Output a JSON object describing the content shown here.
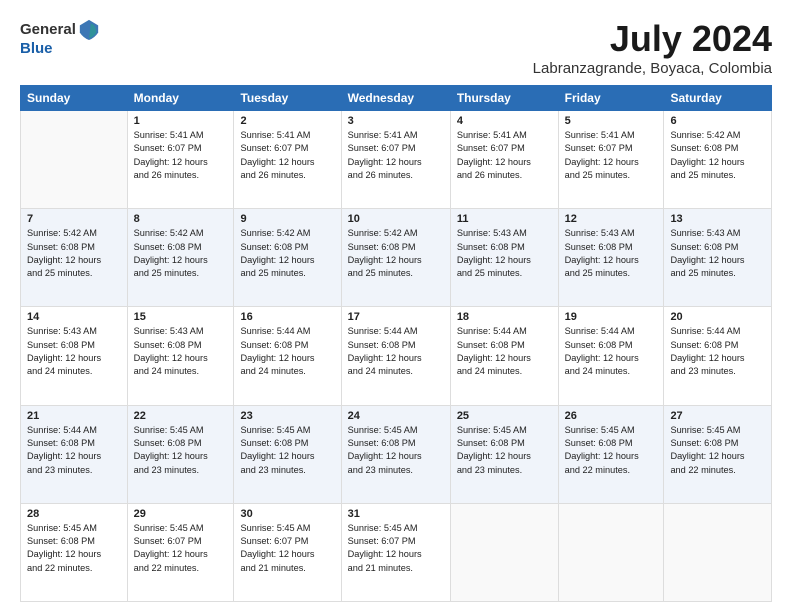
{
  "header": {
    "logo_general": "General",
    "logo_blue": "Blue",
    "month": "July 2024",
    "location": "Labranzagrande, Boyaca, Colombia"
  },
  "weekdays": [
    "Sunday",
    "Monday",
    "Tuesday",
    "Wednesday",
    "Thursday",
    "Friday",
    "Saturday"
  ],
  "weeks": [
    [
      {
        "day": "",
        "info": ""
      },
      {
        "day": "1",
        "info": "Sunrise: 5:41 AM\nSunset: 6:07 PM\nDaylight: 12 hours\nand 26 minutes."
      },
      {
        "day": "2",
        "info": "Sunrise: 5:41 AM\nSunset: 6:07 PM\nDaylight: 12 hours\nand 26 minutes."
      },
      {
        "day": "3",
        "info": "Sunrise: 5:41 AM\nSunset: 6:07 PM\nDaylight: 12 hours\nand 26 minutes."
      },
      {
        "day": "4",
        "info": "Sunrise: 5:41 AM\nSunset: 6:07 PM\nDaylight: 12 hours\nand 26 minutes."
      },
      {
        "day": "5",
        "info": "Sunrise: 5:41 AM\nSunset: 6:07 PM\nDaylight: 12 hours\nand 25 minutes."
      },
      {
        "day": "6",
        "info": "Sunrise: 5:42 AM\nSunset: 6:08 PM\nDaylight: 12 hours\nand 25 minutes."
      }
    ],
    [
      {
        "day": "7",
        "info": "Sunrise: 5:42 AM\nSunset: 6:08 PM\nDaylight: 12 hours\nand 25 minutes."
      },
      {
        "day": "8",
        "info": "Sunrise: 5:42 AM\nSunset: 6:08 PM\nDaylight: 12 hours\nand 25 minutes."
      },
      {
        "day": "9",
        "info": "Sunrise: 5:42 AM\nSunset: 6:08 PM\nDaylight: 12 hours\nand 25 minutes."
      },
      {
        "day": "10",
        "info": "Sunrise: 5:42 AM\nSunset: 6:08 PM\nDaylight: 12 hours\nand 25 minutes."
      },
      {
        "day": "11",
        "info": "Sunrise: 5:43 AM\nSunset: 6:08 PM\nDaylight: 12 hours\nand 25 minutes."
      },
      {
        "day": "12",
        "info": "Sunrise: 5:43 AM\nSunset: 6:08 PM\nDaylight: 12 hours\nand 25 minutes."
      },
      {
        "day": "13",
        "info": "Sunrise: 5:43 AM\nSunset: 6:08 PM\nDaylight: 12 hours\nand 25 minutes."
      }
    ],
    [
      {
        "day": "14",
        "info": "Sunrise: 5:43 AM\nSunset: 6:08 PM\nDaylight: 12 hours\nand 24 minutes."
      },
      {
        "day": "15",
        "info": "Sunrise: 5:43 AM\nSunset: 6:08 PM\nDaylight: 12 hours\nand 24 minutes."
      },
      {
        "day": "16",
        "info": "Sunrise: 5:44 AM\nSunset: 6:08 PM\nDaylight: 12 hours\nand 24 minutes."
      },
      {
        "day": "17",
        "info": "Sunrise: 5:44 AM\nSunset: 6:08 PM\nDaylight: 12 hours\nand 24 minutes."
      },
      {
        "day": "18",
        "info": "Sunrise: 5:44 AM\nSunset: 6:08 PM\nDaylight: 12 hours\nand 24 minutes."
      },
      {
        "day": "19",
        "info": "Sunrise: 5:44 AM\nSunset: 6:08 PM\nDaylight: 12 hours\nand 24 minutes."
      },
      {
        "day": "20",
        "info": "Sunrise: 5:44 AM\nSunset: 6:08 PM\nDaylight: 12 hours\nand 23 minutes."
      }
    ],
    [
      {
        "day": "21",
        "info": "Sunrise: 5:44 AM\nSunset: 6:08 PM\nDaylight: 12 hours\nand 23 minutes."
      },
      {
        "day": "22",
        "info": "Sunrise: 5:45 AM\nSunset: 6:08 PM\nDaylight: 12 hours\nand 23 minutes."
      },
      {
        "day": "23",
        "info": "Sunrise: 5:45 AM\nSunset: 6:08 PM\nDaylight: 12 hours\nand 23 minutes."
      },
      {
        "day": "24",
        "info": "Sunrise: 5:45 AM\nSunset: 6:08 PM\nDaylight: 12 hours\nand 23 minutes."
      },
      {
        "day": "25",
        "info": "Sunrise: 5:45 AM\nSunset: 6:08 PM\nDaylight: 12 hours\nand 23 minutes."
      },
      {
        "day": "26",
        "info": "Sunrise: 5:45 AM\nSunset: 6:08 PM\nDaylight: 12 hours\nand 22 minutes."
      },
      {
        "day": "27",
        "info": "Sunrise: 5:45 AM\nSunset: 6:08 PM\nDaylight: 12 hours\nand 22 minutes."
      }
    ],
    [
      {
        "day": "28",
        "info": "Sunrise: 5:45 AM\nSunset: 6:08 PM\nDaylight: 12 hours\nand 22 minutes."
      },
      {
        "day": "29",
        "info": "Sunrise: 5:45 AM\nSunset: 6:07 PM\nDaylight: 12 hours\nand 22 minutes."
      },
      {
        "day": "30",
        "info": "Sunrise: 5:45 AM\nSunset: 6:07 PM\nDaylight: 12 hours\nand 21 minutes."
      },
      {
        "day": "31",
        "info": "Sunrise: 5:45 AM\nSunset: 6:07 PM\nDaylight: 12 hours\nand 21 minutes."
      },
      {
        "day": "",
        "info": ""
      },
      {
        "day": "",
        "info": ""
      },
      {
        "day": "",
        "info": ""
      }
    ]
  ]
}
